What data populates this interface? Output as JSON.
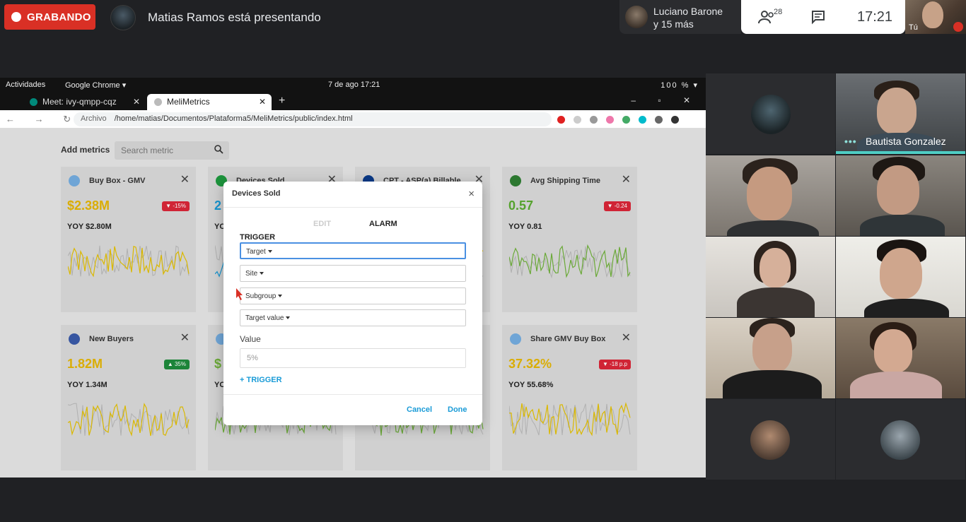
{
  "meet": {
    "recording_label": "GRABANDO",
    "presenter_text": "Matias Ramos está presentando",
    "participants_pill": {
      "name_line1": "Luciano Barone",
      "name_line2": "y 15 más"
    },
    "people_count": "28",
    "clock": "17:21",
    "self_label": "Tú"
  },
  "desktop": {
    "activities": "Actividades",
    "app_menu": "Google Chrome ▾",
    "datetime": "7 de ago  17:21",
    "tray": "100 % ▾"
  },
  "browser": {
    "tabs": [
      {
        "label": "Meet: ivy-qmpp-cqz"
      },
      {
        "label": "MeliMetrics"
      }
    ],
    "url_prefix": "Archivo",
    "url": "/home/matias/Documentos/Plataforma5/MeliMetrics/public/index.html",
    "new_tab": "+",
    "window_controls": "–  ▫  ✕"
  },
  "app": {
    "add_metrics_label": "Add metrics",
    "search_placeholder": "Search metric",
    "cards": [
      {
        "title": "Buy Box - GMV",
        "value": "$2.38M",
        "badge": "-15%",
        "yoy": "YOY $2.80M",
        "value_color": "#e3b505",
        "badge_color": "#d92638",
        "badge_dir": "down",
        "flag_color": "#74acdf",
        "line_color": "#e3c000"
      },
      {
        "title": "Devices Sold",
        "value": "2",
        "badge": "",
        "yoy": "YO",
        "value_color": "#1a9bd7",
        "badge_color": "",
        "badge_dir": "",
        "flag_color": "#1f9a3f",
        "line_color": "#1a9bd7"
      },
      {
        "title": "CPT - ASP(a) Billable",
        "value": "",
        "badge": "",
        "yoy": "",
        "value_color": "#2e7d32",
        "badge_color": "",
        "badge_dir": "",
        "flag_color": "#0b3c8c",
        "line_color": "#e3c000"
      },
      {
        "title": "Avg Shipping Time",
        "value": "0.57",
        "badge": "-0.24",
        "yoy": "YOY 0.81",
        "value_color": "#59a92f",
        "badge_color": "#d92638",
        "badge_dir": "down",
        "flag_color": "#2e7d32",
        "line_color": "#6fb03a"
      },
      {
        "title": "New Buyers",
        "value": "1.82M",
        "badge": "35%",
        "yoy": "YOY 1.34M",
        "value_color": "#e3b505",
        "badge_color": "#1e8a3c",
        "badge_dir": "up",
        "flag_color": "#3a5aa8",
        "line_color": "#e3c000"
      },
      {
        "title": "",
        "value": "$",
        "badge": "",
        "yoy": "YO",
        "value_color": "#6fb03a",
        "badge_color": "",
        "badge_dir": "",
        "flag_color": "#74acdf",
        "line_color": "#6fb03a"
      },
      {
        "title": "",
        "value": "",
        "badge": "",
        "yoy": "",
        "value_color": "#6fb03a",
        "badge_color": "",
        "badge_dir": "",
        "flag_color": "#1f9a3f",
        "line_color": "#6fb03a"
      },
      {
        "title": "Share GMV Buy Box",
        "value": "37.32%",
        "badge": "-18 p.p",
        "yoy": "YOY 55.68%",
        "value_color": "#e3b505",
        "badge_color": "#d92638",
        "badge_dir": "down",
        "flag_color": "#74acdf",
        "line_color": "#e3c000"
      }
    ]
  },
  "dialog": {
    "title": "Devices Sold",
    "close": "×",
    "tab_edit": "EDIT",
    "tab_alarm": "ALARM",
    "trigger_heading": "TRIGGER",
    "selects": {
      "target": "Target",
      "site": "Site",
      "subgroup": "Subgroup",
      "target_value": "Target value"
    },
    "value_label": "Value",
    "value_placeholder": "5%",
    "add_trigger": "+ TRIGGER",
    "cancel": "Cancel",
    "done": "Done"
  },
  "participants": {
    "speaker_name": "Bautista Gonzalez",
    "speaker_dots": "•••"
  },
  "colors": {
    "recording_red": "#d93025",
    "link_blue": "#1a9bd7",
    "focus_blue": "#4a90e2",
    "speaking_teal": "#4ecdc4"
  },
  "icons": [
    "people-icon",
    "chat-icon",
    "search-icon",
    "close-icon",
    "mic-off-icon",
    "chevron-down-icon",
    "cursor-icon"
  ]
}
